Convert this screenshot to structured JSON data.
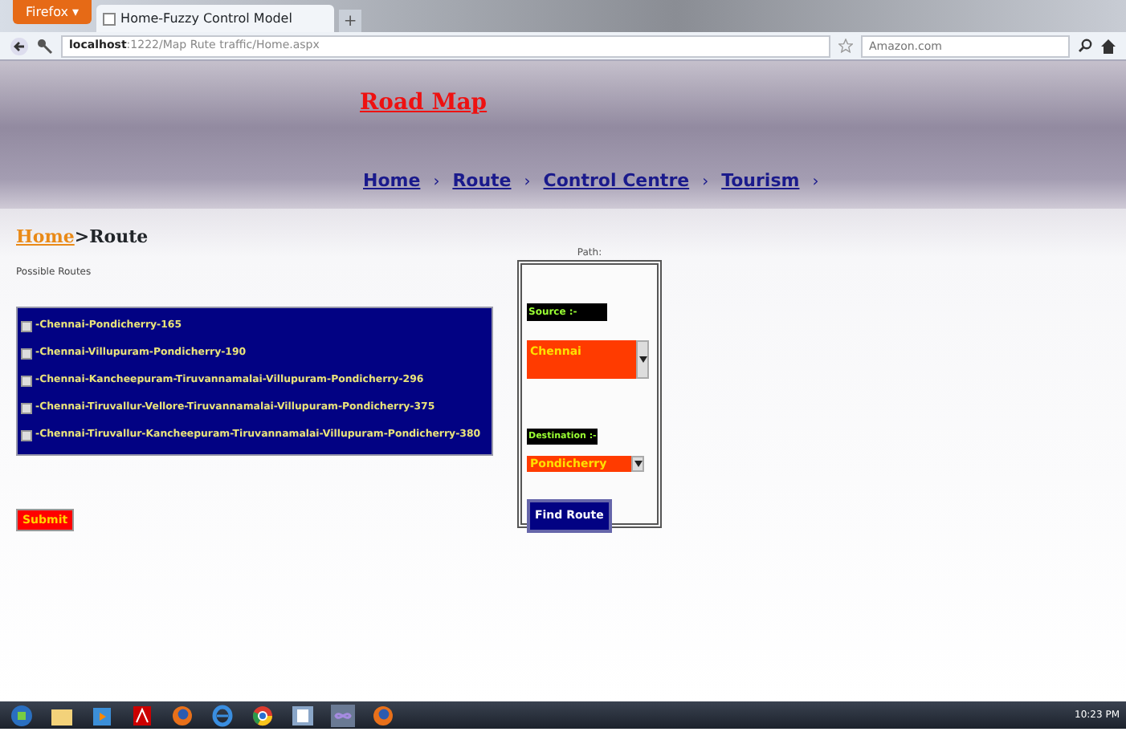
{
  "browser": {
    "menu_button": "Firefox ▾",
    "tab_title": "Home-Fuzzy Control Model",
    "new_tab": "+",
    "url_host": "localhost",
    "url_rest": ":1222/Map Rute traffic/Home.aspx",
    "search_placeholder": "Amazon.com"
  },
  "header": {
    "title": "Road Map",
    "nav": [
      {
        "label": "Home"
      },
      {
        "label": "Route"
      },
      {
        "label": "Control Centre"
      },
      {
        "label": "Tourism"
      }
    ],
    "separator": "›"
  },
  "breadcrumb": {
    "link": "Home",
    "separator": ">",
    "current": "Route"
  },
  "routes_label": "Possible Routes",
  "routes": [
    {
      "label": "-Chennai-Pondicherry-165",
      "checked": false
    },
    {
      "label": "-Chennai-Villupuram-Pondicherry-190",
      "checked": false
    },
    {
      "label": "-Chennai-Kancheepuram-Tiruvannamalai-Villupuram-Pondicherry-296",
      "checked": false
    },
    {
      "label": "-Chennai-Tiruvallur-Vellore-Tiruvannamalai-Villupuram-Pondicherry-375",
      "checked": false
    },
    {
      "label": "-Chennai-Tiruvallur-Kancheepuram-Tiruvannamalai-Villupuram-Pondicherry-380",
      "checked": false
    }
  ],
  "submit": "Submit",
  "path": {
    "caption": "Path:",
    "source_label": "Source :-",
    "source_value": "Chennai",
    "destination_label": "Destination :-",
    "destination_value": "Pondicherry",
    "button": "Find Route"
  },
  "taskbar": {
    "clock": "10:23 PM"
  }
}
